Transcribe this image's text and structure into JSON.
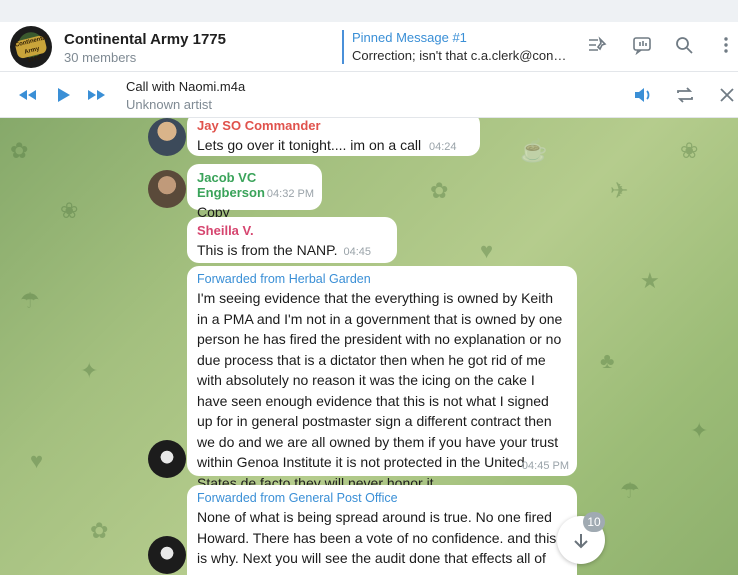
{
  "header": {
    "title": "Continental Army 1775",
    "members": "30 members",
    "avatar_text": "Continental Army 1775",
    "pinned_title": "Pinned Message #1",
    "pinned_preview": "Correction; isn't that c.a.clerk@conti..."
  },
  "player": {
    "track": "Call with Naomi.m4a",
    "artist": "Unknown artist"
  },
  "messages": [
    {
      "sender": "Jay SO Commander",
      "text": "Lets go over it tonight.... im on a call",
      "time": "04:24 PM"
    },
    {
      "sender": "Jacob VC Engberson",
      "text": "Copy",
      "time": "04:32 PM"
    },
    {
      "sender": "Sheilla V.",
      "text": "This is from the NANP.",
      "time": "04:45 PM"
    },
    {
      "forwarded": "Forwarded from Herbal Garden",
      "text": "I'm seeing evidence that the everything is owned by Keith in a PMA and I'm not in a government that is owned by one person he has fired the president with no explanation or no due process that is a dictator then when he got rid of me with absolutely no reason it was the icing on the cake I have seen enough evidence that this is not what I signed up for in general postmaster sign a different contract then we do and we are all owned by them if you have your trust within Genoa Institute it is not protected in the United States de facto they will never honor it",
      "time": "04:45 PM"
    },
    {
      "forwarded": "Forwarded from General Post Office",
      "text": "None of what is being spread around is true. No one fired Howard. There has been a vote of no confidence. and this is why. Next you will see the audit done that effects all of"
    }
  ],
  "unread_count": "10",
  "colors": {
    "accent": "#3a8fd6",
    "sender_red": "#e0524c",
    "sender_green": "#3aa35a",
    "sender_pink": "#d6456f"
  },
  "icons": [
    "rewind-icon",
    "play-icon",
    "fast-forward-icon",
    "volume-icon",
    "repeat-icon",
    "close-icon",
    "pin-list-icon",
    "video-chat-icon",
    "search-icon",
    "more-icon",
    "arrow-down-icon"
  ]
}
